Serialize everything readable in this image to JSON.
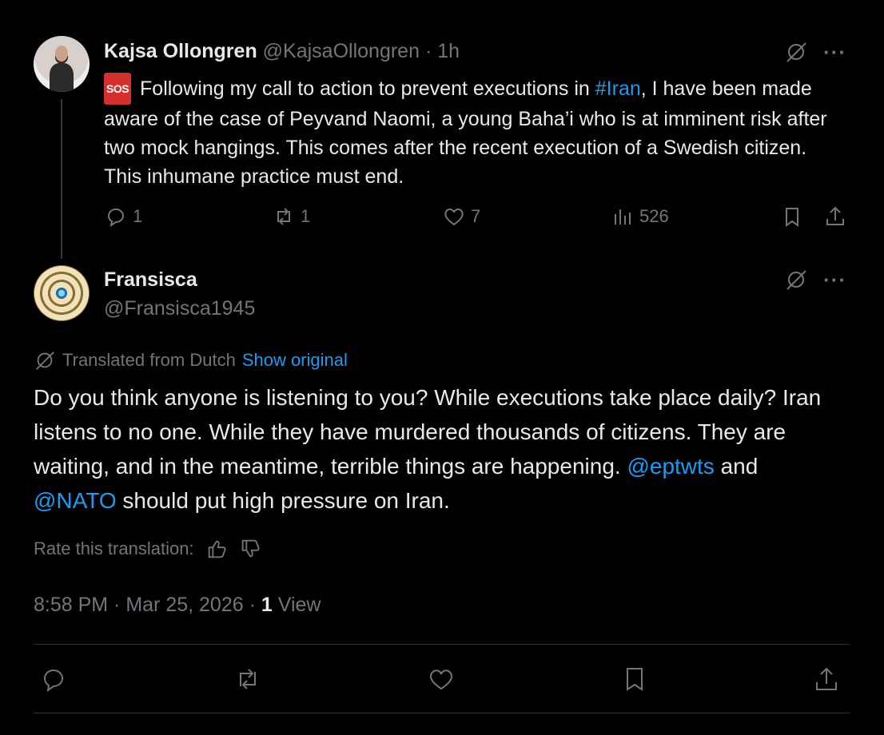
{
  "tweet1": {
    "author_name": "Kajsa Ollongren",
    "author_handle": "@KajsaOllongren",
    "separator": "·",
    "time": "1h",
    "sos_badge": "SOS",
    "text_before_hashtag": " Following my call to action to prevent executions in ",
    "hashtag": "#Iran",
    "text_after_hashtag": ", I have been made aware of the case of Peyvand Naomi, a young Baha’i who is at imminent risk after two mock hangings. This comes after the recent execution of a Swedish citizen. This inhumane practice must end.",
    "stats": {
      "replies": "1",
      "reposts": "1",
      "likes": "7",
      "views": "526"
    },
    "more_label": "···"
  },
  "reply": {
    "author_name": "Fransisca",
    "author_handle": "@Fransisca1945",
    "more_label": "···",
    "translated_label": "Translated from Dutch",
    "show_original_label": "Show original",
    "text_part1": "Do you think anyone is listening to you? While executions take place daily? Iran listens to no one. While they have murdered thousands of citizens. They are waiting, and in the meantime, terrible things are happening. ",
    "mention1": "@eptwts",
    "text_part2": " and ",
    "mention2": "@NATO",
    "text_part3": " should put high pressure on Iran.",
    "rate_label": "Rate this translation:",
    "timestamp": "8:58 PM · Mar 25, 2026 · ",
    "view_count": "1",
    "view_label": "View"
  },
  "icons": {
    "grok": "grok-icon",
    "reply": "reply-icon",
    "repost": "repost-icon",
    "like": "heart-icon",
    "views": "views-icon",
    "bookmark": "bookmark-icon",
    "share": "share-icon",
    "thumbs_up": "thumbs-up-icon",
    "thumbs_down": "thumbs-down-icon",
    "translate": "translate-icon"
  },
  "colors": {
    "background": "#000000",
    "text": "#e7e9ea",
    "muted": "#71767b",
    "link": "#1d9bf0",
    "sos": "#d3302f"
  }
}
